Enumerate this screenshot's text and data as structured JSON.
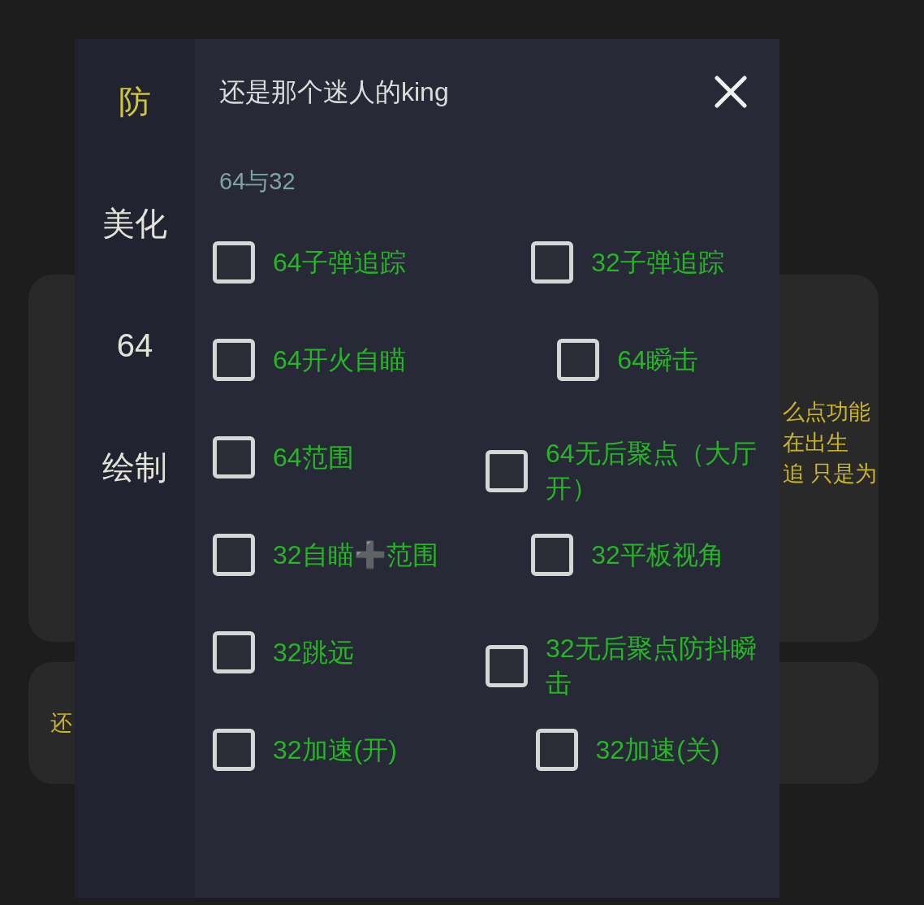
{
  "background_cards": [
    {
      "kind": "large",
      "lines": [
        "么点功能",
        "在出生",
        "追 只是为"
      ]
    },
    {
      "kind": "small",
      "lines": [
        "还"
      ]
    }
  ],
  "dialog": {
    "tabs": [
      {
        "label": "防",
        "selected": true
      },
      {
        "label": "美化",
        "selected": false
      },
      {
        "label": "64",
        "selected": false
      },
      {
        "label": "绘制",
        "selected": false
      }
    ],
    "title": "还是那个迷人的king",
    "section_title": "64与32",
    "options": [
      {
        "label": "64子弹追踪",
        "checked": false
      },
      {
        "label": "32子弹追踪",
        "checked": false
      },
      {
        "label": "64开火自瞄",
        "checked": false
      },
      {
        "label": "64瞬击",
        "checked": false
      },
      {
        "label": "64范围",
        "checked": false
      },
      {
        "label": "64无后聚点（大厅开）",
        "checked": false
      },
      {
        "label": "32自瞄➕范围",
        "checked": false
      },
      {
        "label": "32平板视角",
        "checked": false
      },
      {
        "label": "32跳远",
        "checked": false
      },
      {
        "label": "32无后聚点防抖瞬击",
        "checked": false
      },
      {
        "label": "32加速(开)",
        "checked": false
      },
      {
        "label": "32加速(关)",
        "checked": false
      }
    ]
  }
}
